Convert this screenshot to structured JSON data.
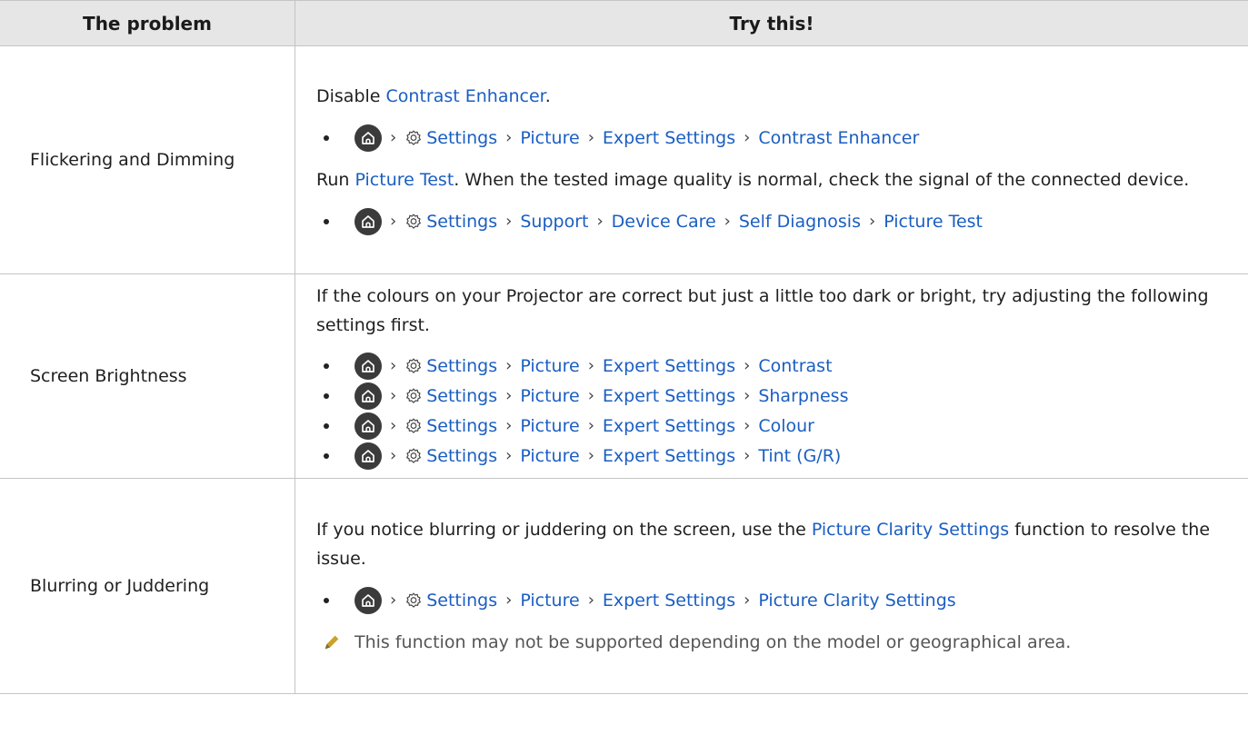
{
  "table": {
    "headers": [
      "The problem",
      "Try this!"
    ],
    "rows": [
      {
        "problem": "Flickering and Dimming",
        "p1": [
          "Disable ",
          "Contrast Enhancer",
          "."
        ],
        "path1": [
          "Settings",
          "Picture",
          "Expert Settings",
          "Contrast Enhancer"
        ],
        "p2": [
          "Run ",
          "Picture Test",
          ". When the tested image quality is normal, check the signal of the connected device."
        ],
        "path2": [
          "Settings",
          "Support",
          "Device Care",
          "Self Diagnosis",
          "Picture Test"
        ]
      },
      {
        "problem": "Screen Brightness",
        "p1": "If the colours on your Projector are correct but just a little too dark or bright, try adjusting the following settings first.",
        "paths": [
          [
            "Settings",
            "Picture",
            "Expert Settings",
            "Contrast"
          ],
          [
            "Settings",
            "Picture",
            "Expert Settings",
            "Sharpness"
          ],
          [
            "Settings",
            "Picture",
            "Expert Settings",
            "Colour"
          ],
          [
            "Settings",
            "Picture",
            "Expert Settings",
            "Tint (G/R)"
          ]
        ]
      },
      {
        "problem": "Blurring or Juddering",
        "p1": [
          "If you notice blurring or juddering on the screen, use the ",
          "Picture Clarity Settings",
          " function to resolve the issue."
        ],
        "path1": [
          "Settings",
          "Picture",
          "Expert Settings",
          "Picture Clarity Settings"
        ],
        "note": "This function may not be supported depending on the model or geographical area."
      }
    ]
  },
  "icons": {
    "home": "home-icon",
    "settings": "gear-icon",
    "separator": "chevron-right",
    "note": "pencil-note-icon"
  },
  "colors": {
    "link": "#1a5ec2",
    "header_bg": "#e6e6e6",
    "border": "#c4c4c4",
    "home_icon_bg": "#3b3b3b"
  }
}
